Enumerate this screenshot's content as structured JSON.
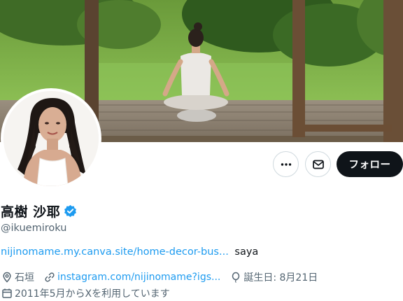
{
  "profile": {
    "display_name": "高樹 沙耶",
    "handle": "@ikuemiroku",
    "verified": true,
    "bio_link": "nijinomame.my.canva.site/home-decor-bus...",
    "bio_text": "saya",
    "location": "石垣",
    "website": "instagram.com/nijinomame?igs...",
    "birthday": "誕生日: 8月21日",
    "joined": "2011年5月からXを利用しています"
  },
  "actions": {
    "follow_label": "フォロー",
    "more_icon": "more-horizontal-icon",
    "message_icon": "mail-icon"
  },
  "colors": {
    "link": "#1d9bf0",
    "verified_badge": "#1d9bf0",
    "follow_button": "#0f1419",
    "secondary_text": "#536471"
  }
}
